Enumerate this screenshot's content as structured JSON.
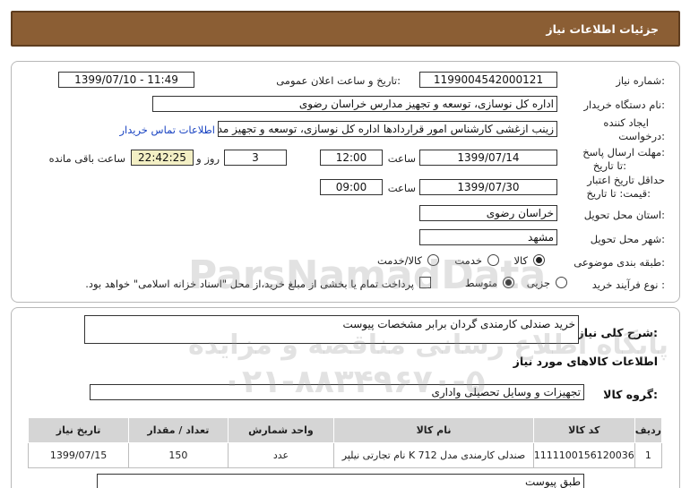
{
  "header": {
    "title": "جزئیات اطلاعات نیاز"
  },
  "form": {
    "need_number": {
      "label": "شماره نیاز:",
      "value": "1199004542000121"
    },
    "announce": {
      "label": "تاریخ و ساعت اعلان عمومی:",
      "value": "1399/07/10 - 11:49"
    },
    "buyer": {
      "label": "نام دستگاه خریدار:",
      "value": "اداره کل نوسازی، توسعه و تجهیز مدارس خراسان رضوی"
    },
    "creator": {
      "label_line1": "ایجاد کننده",
      "label_line2": "درخواست:",
      "value": "زینب ازغشی کارشناس امور قراردادها اداره کل نوسازی، توسعه و تجهیز مدارس",
      "contact_link": "اطلاعات تماس خریدار"
    },
    "reply_deadline": {
      "label_line1": "مهلت ارسال پاسخ:",
      "label_line2": "تا تاریخ:",
      "date": "1399/07/14",
      "time_label": "ساعت",
      "time": "12:00",
      "days": "3",
      "days_label": "روز و",
      "remaining": "22:42:25",
      "remaining_label": "ساعت باقی مانده"
    },
    "price_validity": {
      "label_line1": "حداقل تاریخ اعتبار",
      "label_line2": "قیمت: تا تاریخ:",
      "date": "1399/07/30",
      "time_label": "ساعت",
      "time": "09:00"
    },
    "province": {
      "label": "استان محل تحویل:",
      "value": "خراسان رضوی"
    },
    "city": {
      "label": "شهر محل تحویل:",
      "value": "مشهد"
    },
    "category": {
      "label": "طبقه بندی موضوعی:",
      "options": [
        "کالا",
        "خدمت",
        "کالا/خدمت"
      ],
      "selected": "کالا"
    },
    "purchase_type": {
      "label": "نوع فرآیند خرید :",
      "options": [
        "جزیی",
        "متوسط"
      ],
      "selected": "متوسط",
      "treasury_note": "پرداخت تمام یا بخشی از مبلغ خرید،از محل \"اسناد خزانه اسلامی\" خواهد بود."
    }
  },
  "need_summary": {
    "label": "شرح کلی نیاز:",
    "value": "خرید صندلی کارمندی گردان برابر مشخصات پیوست"
  },
  "goods_info": {
    "title": "اطلاعات کالاهای مورد نیاز",
    "group_label": "گروه کالا:",
    "group_value": "تجهیزات و وسایل تحصیلی واداری",
    "columns": [
      "ردیف",
      "کد کالا",
      "نام کالا",
      "واحد شمارش",
      "تعداد / مقدار",
      "تاریخ نیاز"
    ],
    "rows": [
      {
        "row": "1",
        "code": "1111100156120036",
        "name": "صندلی کارمندی مدل K 712 نام تجارتی نیلپر",
        "unit": "عدد",
        "qty": "150",
        "date": "1399/07/15"
      }
    ],
    "note": "طبق پیوست"
  },
  "watermark": {
    "brand": "ParsNamadData",
    "line1": "پایگاه اطلاع رسانی مناقصه و مزایده",
    "phone": "۰۲۱-۸۸۳۴۹۶۷۰-۵"
  }
}
